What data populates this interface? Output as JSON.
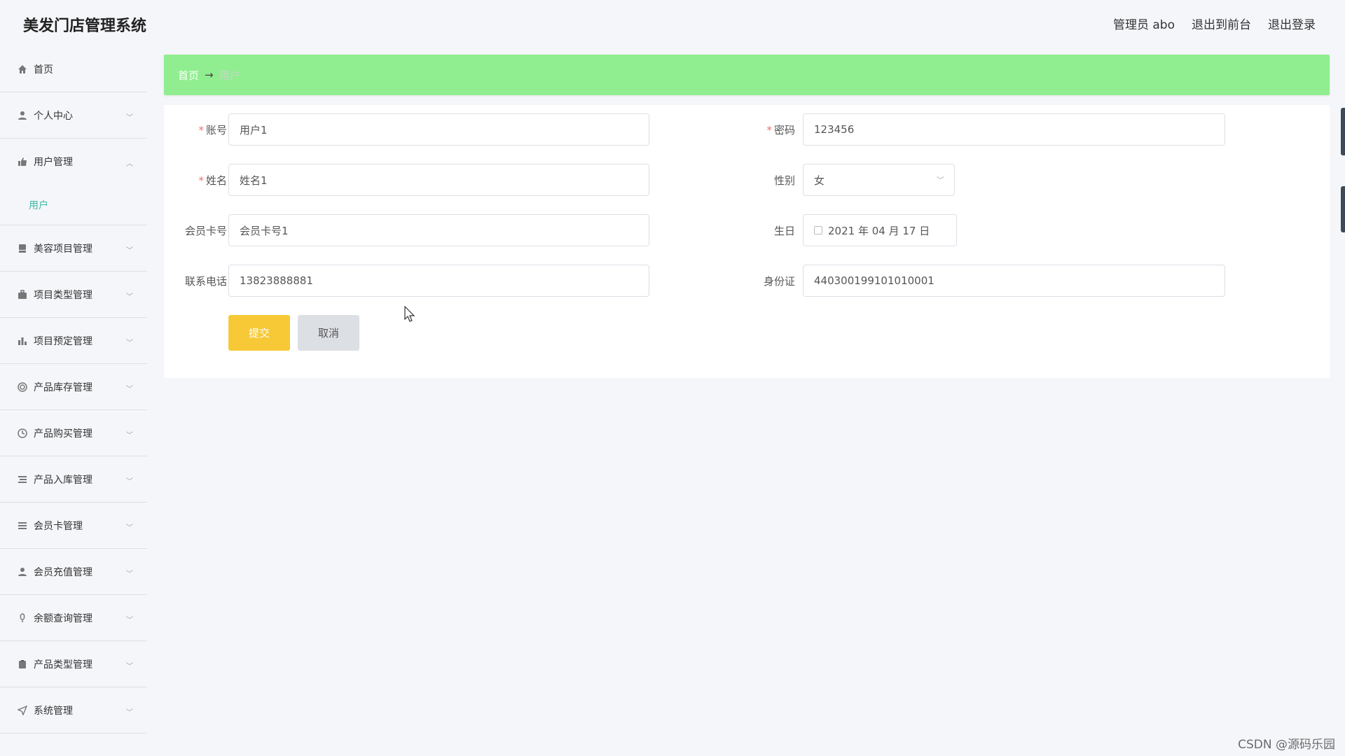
{
  "app": {
    "title": "美发门店管理系统"
  },
  "header": {
    "user_label": "管理员 abo",
    "back_front_label": "退出到前台",
    "logout_label": "退出登录"
  },
  "sidebar": {
    "items": [
      {
        "label": "首页",
        "icon": "home-icon"
      },
      {
        "label": "个人中心",
        "icon": "user-icon"
      },
      {
        "label": "用户管理",
        "icon": "thumb-icon",
        "expanded": true,
        "children": [
          {
            "label": "用户"
          }
        ]
      },
      {
        "label": "美容项目管理",
        "icon": "chair-icon"
      },
      {
        "label": "项目类型管理",
        "icon": "briefcase-icon"
      },
      {
        "label": "项目预定管理",
        "icon": "bar-chart-icon"
      },
      {
        "label": "产品库存管理",
        "icon": "lifebuoy-icon"
      },
      {
        "label": "产品购买管理",
        "icon": "clock-icon"
      },
      {
        "label": "产品入库管理",
        "icon": "list-icon"
      },
      {
        "label": "会员卡管理",
        "icon": "menu-icon"
      },
      {
        "label": "会员充值管理",
        "icon": "user-icon"
      },
      {
        "label": "余额查询管理",
        "icon": "mic-icon"
      },
      {
        "label": "产品类型管理",
        "icon": "clipboard-icon"
      },
      {
        "label": "系统管理",
        "icon": "send-icon"
      }
    ]
  },
  "breadcrumb": {
    "home": "首页",
    "separator": "→",
    "current": "用户"
  },
  "form": {
    "account": {
      "label": "账号",
      "value": "用户1",
      "required": true
    },
    "password": {
      "label": "密码",
      "value": "123456",
      "required": true
    },
    "name": {
      "label": "姓名",
      "value": "姓名1",
      "required": true
    },
    "gender": {
      "label": "性别",
      "value": "女"
    },
    "card_no": {
      "label": "会员卡号",
      "value": "会员卡号1"
    },
    "birthday": {
      "label": "生日",
      "value": "2021 年 04 月 17 日"
    },
    "phone": {
      "label": "联系电话",
      "value": "13823888881"
    },
    "id_card": {
      "label": "身份证",
      "value": "440300199101010001"
    },
    "submit_label": "提交",
    "cancel_label": "取消"
  },
  "colors": {
    "breadcrumb_bg": "#90ee90",
    "submit_bg": "#f7c936",
    "active_submenu": "#3bb8a5"
  },
  "watermark": "CSDN @源码乐园"
}
